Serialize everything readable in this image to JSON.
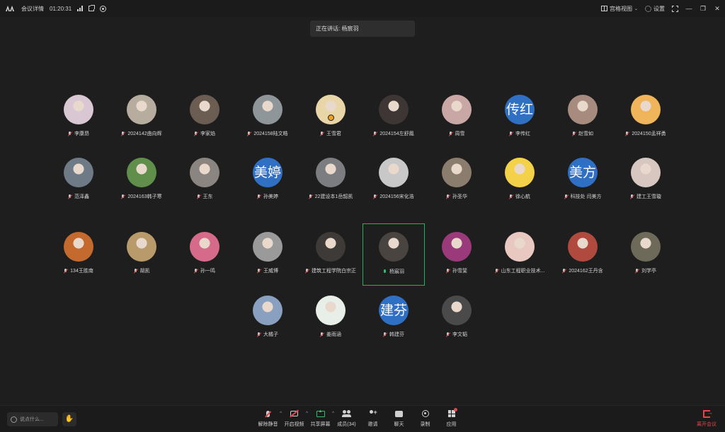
{
  "topbar": {
    "meeting_details": "会议详情",
    "duration": "01:20:31",
    "view_mode": "宫格视图",
    "settings": "设置"
  },
  "speaking": "正在讲话: 杨宸羽",
  "participants": [
    {
      "name": "李康昂",
      "avatar": {
        "type": "photo",
        "bg": "#d9c8d4"
      },
      "mic": "off"
    },
    {
      "name": "2024142曲向辉",
      "avatar": {
        "type": "photo",
        "bg": "#b7ad9e"
      },
      "mic": "off"
    },
    {
      "name": "李家焰",
      "avatar": {
        "type": "photo",
        "bg": "#6b5d52"
      },
      "mic": "off"
    },
    {
      "name": "2024158陆文皓",
      "avatar": {
        "type": "photo",
        "bg": "#8e9699"
      },
      "mic": "off"
    },
    {
      "name": "王雪君",
      "avatar": {
        "type": "photo",
        "bg": "#e8d6a8"
      },
      "mic": "off",
      "host": true
    },
    {
      "name": "2024154左舒鳳",
      "avatar": {
        "type": "photo",
        "bg": "#3d3635"
      },
      "mic": "off"
    },
    {
      "name": "周雪",
      "avatar": {
        "type": "photo",
        "bg": "#c9a7a4"
      },
      "mic": "off"
    },
    {
      "name": "李传红",
      "avatar": {
        "type": "text",
        "text": "传红",
        "bg": "#2f6fc4"
      },
      "mic": "off"
    },
    {
      "name": "赵雪如",
      "avatar": {
        "type": "photo",
        "bg": "#a78b7e"
      },
      "mic": "off"
    },
    {
      "name": "2024150孟祥勇",
      "avatar": {
        "type": "photo",
        "bg": "#f0b45a"
      },
      "mic": "off"
    },
    {
      "name": "范泽鑫",
      "avatar": {
        "type": "photo",
        "bg": "#6e7a86"
      },
      "mic": "off"
    },
    {
      "name": "2024163韩子寒",
      "avatar": {
        "type": "photo",
        "bg": "#5f8f4a"
      },
      "mic": "off"
    },
    {
      "name": "王东",
      "avatar": {
        "type": "photo",
        "bg": "#8a8580"
      },
      "mic": "off"
    },
    {
      "name": "孙美婷",
      "avatar": {
        "type": "text",
        "text": "美婷",
        "bg": "#2f6fc4"
      },
      "mic": "off"
    },
    {
      "name": "22建设本1岳韶凯",
      "avatar": {
        "type": "photo",
        "bg": "#7b7d80"
      },
      "mic": "off"
    },
    {
      "name": "2024156宋化浩",
      "avatar": {
        "type": "photo",
        "bg": "#c8c8c8"
      },
      "mic": "off"
    },
    {
      "name": "孙圣华",
      "avatar": {
        "type": "photo",
        "bg": "#8a7d6e"
      },
      "mic": "off"
    },
    {
      "name": "徐心航",
      "avatar": {
        "type": "photo",
        "bg": "#f3d24a"
      },
      "mic": "off"
    },
    {
      "name": "科技处 闫美方",
      "avatar": {
        "type": "text",
        "text": "美方",
        "bg": "#2f6fc4"
      },
      "mic": "off"
    },
    {
      "name": "建工王雪璇",
      "avatar": {
        "type": "photo",
        "bg": "#d8c6c0"
      },
      "mic": "off"
    },
    {
      "name": "134王胜南",
      "avatar": {
        "type": "photo",
        "bg": "#c46a2f"
      },
      "mic": "off"
    },
    {
      "name": "胡凯",
      "avatar": {
        "type": "photo",
        "bg": "#b99a6a"
      },
      "mic": "off"
    },
    {
      "name": "孙一鸣",
      "avatar": {
        "type": "photo",
        "bg": "#d66a8a"
      },
      "mic": "off"
    },
    {
      "name": "王威博",
      "avatar": {
        "type": "photo",
        "bg": "#9a9a9a"
      },
      "mic": "off"
    },
    {
      "name": "建筑工程学院白宗正",
      "avatar": {
        "type": "photo",
        "bg": "#3e3a38"
      },
      "mic": "off"
    },
    {
      "name": "杨宸羽",
      "avatar": {
        "type": "photo",
        "bg": "#4a4440"
      },
      "mic": "on",
      "active": true
    },
    {
      "name": "孙雪斐",
      "avatar": {
        "type": "photo",
        "bg": "#9a3a7a"
      },
      "mic": "off"
    },
    {
      "name": "山东工程职业技术...",
      "avatar": {
        "type": "photo",
        "bg": "#e8c8c0"
      },
      "mic": "off"
    },
    {
      "name": "2024162王丹含",
      "avatar": {
        "type": "photo",
        "bg": "#b04a3e"
      },
      "mic": "off"
    },
    {
      "name": "刘学亭",
      "avatar": {
        "type": "photo",
        "bg": "#6e6a5a"
      },
      "mic": "off"
    },
    {
      "name": "大橘子",
      "avatar": {
        "type": "photo",
        "bg": "#8aa0c0"
      },
      "mic": "off"
    },
    {
      "name": "姜雨涵",
      "avatar": {
        "type": "photo",
        "bg": "#e8eee8"
      },
      "mic": "off"
    },
    {
      "name": "韩建芬",
      "avatar": {
        "type": "text",
        "text": "建芬",
        "bg": "#2f6fc4"
      },
      "mic": "off"
    },
    {
      "name": "李文韬",
      "avatar": {
        "type": "photo",
        "bg": "#4a4a4a"
      },
      "mic": "off"
    }
  ],
  "bottombar": {
    "chat_placeholder": "说点什么...",
    "tools": [
      {
        "label": "解除静音",
        "icon": "mic-muted-icon",
        "caret": true
      },
      {
        "label": "开启视频",
        "icon": "camera-off-icon",
        "caret": true
      },
      {
        "label": "共享屏幕",
        "icon": "share-screen-icon",
        "caret": true
      },
      {
        "label": "成员(34)",
        "icon": "members-icon",
        "caret": false
      },
      {
        "label": "邀请",
        "icon": "invite-icon",
        "caret": false
      },
      {
        "label": "聊天",
        "icon": "chat-icon",
        "caret": false
      },
      {
        "label": "录制",
        "icon": "record-icon",
        "caret": false
      },
      {
        "label": "应用",
        "icon": "apps-icon",
        "caret": false
      }
    ],
    "leave_label": "离开会议"
  }
}
